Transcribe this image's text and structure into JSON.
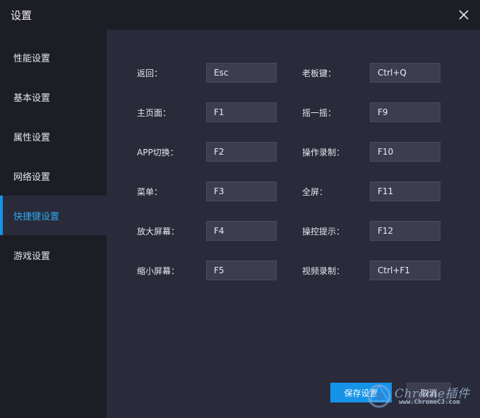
{
  "window": {
    "title": "设置"
  },
  "sidebar": {
    "items": [
      {
        "label": "性能设置",
        "active": false
      },
      {
        "label": "基本设置",
        "active": false
      },
      {
        "label": "属性设置",
        "active": false
      },
      {
        "label": "网络设置",
        "active": false
      },
      {
        "label": "快捷键设置",
        "active": true
      },
      {
        "label": "游戏设置",
        "active": false
      }
    ]
  },
  "shortcuts": {
    "left": [
      {
        "label": "返回：",
        "value": "Esc"
      },
      {
        "label": "主页面：",
        "value": "F1"
      },
      {
        "label": "APP切换：",
        "value": "F2"
      },
      {
        "label": "菜单：",
        "value": "F3"
      },
      {
        "label": "放大屏幕：",
        "value": "F4"
      },
      {
        "label": "缩小屏幕：",
        "value": "F5"
      }
    ],
    "right": [
      {
        "label": "老板键：",
        "value": "Ctrl+Q"
      },
      {
        "label": "摇一摇：",
        "value": "F9"
      },
      {
        "label": "操作录制：",
        "value": "F10"
      },
      {
        "label": "全屏：",
        "value": "F11"
      },
      {
        "label": "操控提示：",
        "value": "F12"
      },
      {
        "label": "视频录制：",
        "value": "Ctrl+F1"
      }
    ]
  },
  "footer": {
    "save_label": "保存设置",
    "cancel_label": "取消"
  },
  "watermark": {
    "brand": "Chrome插件",
    "site": "www.ChromeCJ.com"
  },
  "colors": {
    "accent": "#1593e8",
    "active_text": "#2ba7ee",
    "panel_bg": "#292b3a",
    "sidebar_bg": "#1c1d25",
    "input_bg": "#3c3e4f"
  },
  "icons": {
    "close": "close-icon",
    "watermark": "chrome-logo-icon"
  }
}
